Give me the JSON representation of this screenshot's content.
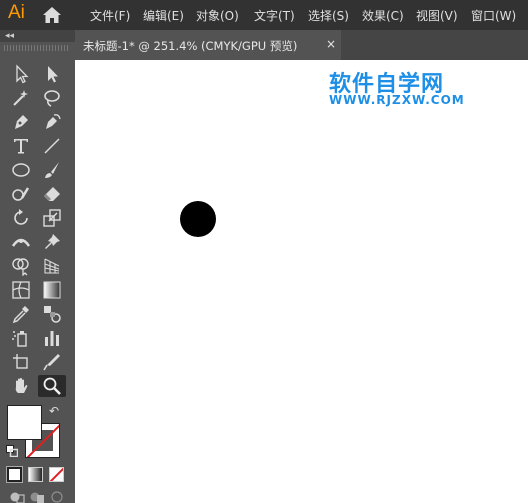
{
  "app": {
    "logo": "Ai"
  },
  "menu": {
    "items": [
      "文件(F)",
      "编辑(E)",
      "对象(O)",
      "文字(T)",
      "选择(S)",
      "效果(C)",
      "视图(V)",
      "窗口(W)"
    ]
  },
  "panel": {
    "collapse_glyph": "◂◂"
  },
  "document": {
    "tab_title": "未标题-1* @ 251.4% (CMYK/GPU 预览)",
    "close_glyph": "×"
  },
  "watermark": {
    "name": "软件自学网",
    "url": "WWW.RJZXW.COM"
  },
  "colors": {
    "menubar": "#323232",
    "panel": "#535353",
    "canvas": "#ffffff",
    "logo": "#ff9a00",
    "watermark": "#1e8fe6",
    "none_slash": "#e02020"
  },
  "tools": [
    [
      "selection-tool",
      "direct-selection-tool"
    ],
    [
      "magic-wand-tool",
      "lasso-tool"
    ],
    [
      "pen-tool",
      "curvature-tool"
    ],
    [
      "type-tool",
      "line-segment-tool"
    ],
    [
      "ellipse-tool",
      "paintbrush-tool"
    ],
    [
      "shaper-tool",
      "eraser-tool"
    ],
    [
      "rotate-tool",
      "scale-tool"
    ],
    [
      "width-tool",
      "puppet-warp-tool"
    ],
    [
      "shape-builder-tool",
      "perspective-grid-tool"
    ],
    [
      "mesh-tool",
      "gradient-tool"
    ],
    [
      "eyedropper-tool",
      "blend-tool"
    ],
    [
      "symbol-sprayer-tool",
      "column-graph-tool"
    ],
    [
      "artboard-tool",
      "slice-tool"
    ],
    [
      "hand-tool",
      "zoom-tool"
    ]
  ],
  "active_tool": "zoom-tool",
  "swap_glyph": "↶"
}
